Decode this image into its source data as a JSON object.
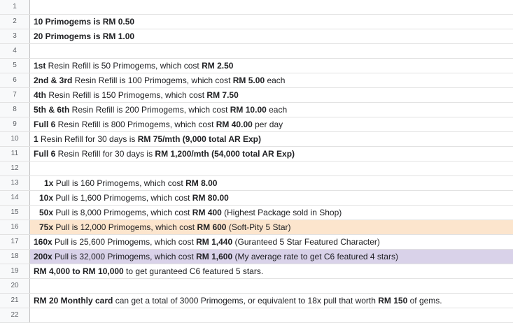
{
  "rows": [
    {
      "n": "1",
      "parts": []
    },
    {
      "n": "2",
      "parts": [
        {
          "t": "10 Primogems is RM 0.50",
          "b": true
        }
      ]
    },
    {
      "n": "3",
      "parts": [
        {
          "t": "20 Primogems is RM 1.00",
          "b": true
        }
      ]
    },
    {
      "n": "4",
      "parts": []
    },
    {
      "n": "5",
      "parts": [
        {
          "t": "1st",
          "b": true
        },
        {
          "t": " Resin Refill is 50 Primogems, which cost "
        },
        {
          "t": "RM 2.50",
          "b": true
        }
      ]
    },
    {
      "n": "6",
      "parts": [
        {
          "t": "2nd & 3rd",
          "b": true
        },
        {
          "t": " Resin Refill is 100 Primogems, which cost "
        },
        {
          "t": "RM 5.00",
          "b": true
        },
        {
          "t": " each"
        }
      ]
    },
    {
      "n": "7",
      "parts": [
        {
          "t": "4th",
          "b": true
        },
        {
          "t": " Resin Refill is 150 Primogems, which cost "
        },
        {
          "t": "RM 7.50",
          "b": true
        }
      ]
    },
    {
      "n": "8",
      "parts": [
        {
          "t": "5th & 6th",
          "b": true
        },
        {
          "t": " Resin Refill is 200 Primogems, which cost "
        },
        {
          "t": "RM 10.00",
          "b": true
        },
        {
          "t": " each"
        }
      ]
    },
    {
      "n": "9",
      "parts": [
        {
          "t": "Full 6",
          "b": true
        },
        {
          "t": " Resin Refill is 800 Primogems, which cost "
        },
        {
          "t": "RM 40.00",
          "b": true
        },
        {
          "t": " per day"
        }
      ]
    },
    {
      "n": "10",
      "parts": [
        {
          "t": "1",
          "b": true
        },
        {
          "t": " Resin Refill for 30 days is "
        },
        {
          "t": "RM 75/mth (9,000 total AR Exp)",
          "b": true
        }
      ]
    },
    {
      "n": "11",
      "parts": [
        {
          "t": "Full 6",
          "b": true
        },
        {
          "t": " Resin Refill for 30 days is "
        },
        {
          "t": "RM 1,200/mth (54,000 total AR Exp)",
          "b": true
        }
      ]
    },
    {
      "n": "12",
      "parts": []
    },
    {
      "n": "13",
      "parts": [
        {
          "t": "1x",
          "b": true
        },
        {
          "t": " Pull is 160 Primogems, which cost "
        },
        {
          "t": "RM 8.00",
          "b": true
        }
      ]
    },
    {
      "n": "14",
      "parts": [
        {
          "t": "10x",
          "b": true
        },
        {
          "t": " Pull is 1,600 Primogems, which cost "
        },
        {
          "t": "RM 80.00",
          "b": true
        }
      ]
    },
    {
      "n": "15",
      "parts": [
        {
          "t": "50x",
          "b": true
        },
        {
          "t": " Pull is 8,000 Primogems, which cost "
        },
        {
          "t": "RM 400",
          "b": true
        },
        {
          "t": " (Highest Package sold in Shop)"
        }
      ]
    },
    {
      "n": "16",
      "hl": "orange",
      "parts": [
        {
          "t": "75x",
          "b": true
        },
        {
          "t": " Pull is 12,000 Primogems, which cost "
        },
        {
          "t": "RM 600",
          "b": true
        },
        {
          "t": " (Soft-Pity 5 Star)"
        }
      ]
    },
    {
      "n": "17",
      "parts": [
        {
          "t": "160x",
          "b": true
        },
        {
          "t": " Pull is 25,600 Primogems, which cost "
        },
        {
          "t": "RM 1,440",
          "b": true
        },
        {
          "t": " (Guranteed 5 Star Featured Character)"
        }
      ]
    },
    {
      "n": "18",
      "hl": "purple",
      "parts": [
        {
          "t": "200x",
          "b": true
        },
        {
          "t": " Pull is 32,000 Primogems, which cost "
        },
        {
          "t": "RM 1,600",
          "b": true
        },
        {
          "t": " (My average rate to get C6 featured 4 stars)"
        }
      ]
    },
    {
      "n": "19",
      "parts": [
        {
          "t": "RM 4,000 to RM 10,000",
          "b": true
        },
        {
          "t": " to get guranteed C6 featured 5 stars."
        }
      ]
    },
    {
      "n": "20",
      "parts": []
    },
    {
      "n": "21",
      "parts": [
        {
          "t": "RM 20 Monthly card",
          "b": true
        },
        {
          "t": " can get a total of 3000 Primogems, or equivalent to 18x pull that worth "
        },
        {
          "t": "RM 150",
          "b": true
        },
        {
          "t": " of gems."
        }
      ]
    },
    {
      "n": "22",
      "parts": []
    }
  ]
}
